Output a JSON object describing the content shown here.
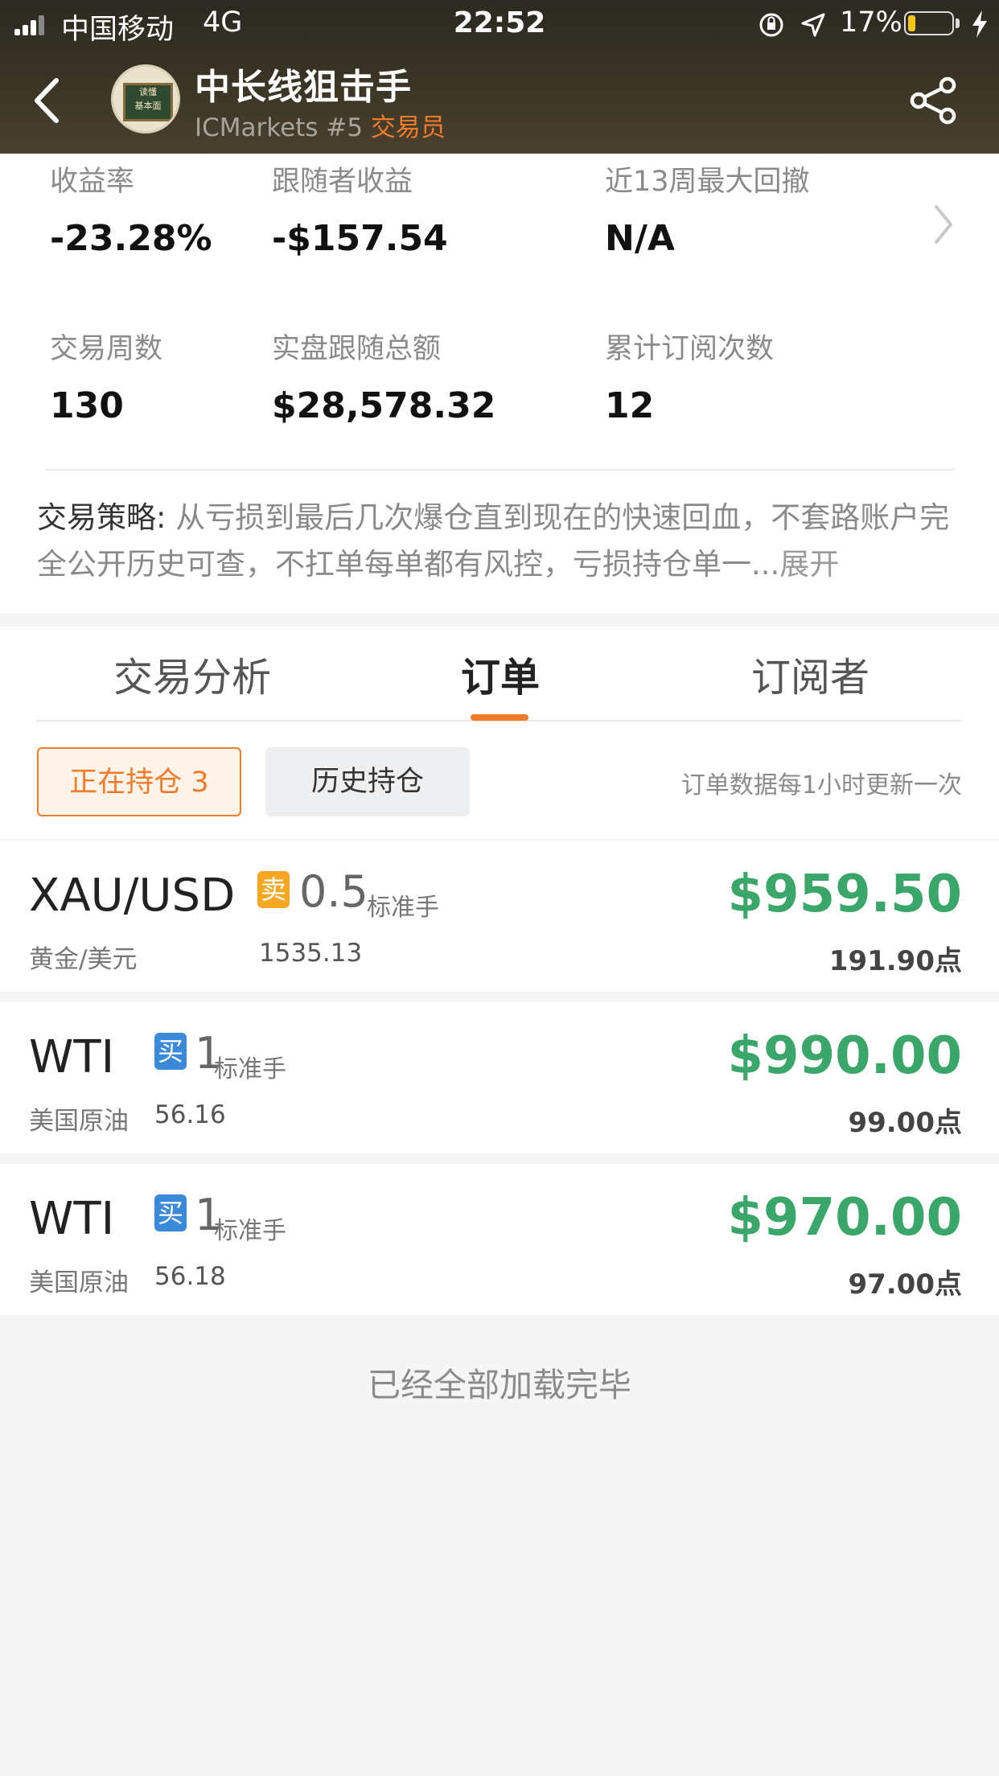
{
  "status_bar": {
    "carrier": "中国移动",
    "network": "4G",
    "time": "22:52",
    "battery": "17%",
    "battery_level": 0.17
  },
  "header": {
    "trader_name": "中长线狙击手",
    "broker": "ICMarkets #5",
    "role": "交易员",
    "avatar_text_1": "读懂",
    "avatar_text_2": "基本面"
  },
  "stats": [
    {
      "label": "收益率",
      "value": "-23.28%"
    },
    {
      "label": "跟随者收益",
      "value": "-$157.54"
    },
    {
      "label": "近13周最大回撤",
      "value": "N/A"
    },
    {
      "label": "交易周数",
      "value": "130"
    },
    {
      "label": "实盘跟随总额",
      "value": "$28,578.32"
    },
    {
      "label": "累计订阅次数",
      "value": "12"
    }
  ],
  "strategy": {
    "prefix": "交易策略: ",
    "text": "从亏损到最后几次爆仓直到现在的快速回血，不套路账户完全公开历史可查，不扛单每单都有风控，亏损持仓单一...",
    "more": "展开"
  },
  "tabs": [
    {
      "label": "交易分析"
    },
    {
      "label": "订单"
    },
    {
      "label": "订阅者"
    }
  ],
  "filters": {
    "open_positions": "正在持仓 3",
    "history": "历史持仓",
    "update_note": "订单数据每1小时更新一次"
  },
  "orders": [
    {
      "symbol": "XAU/USD",
      "side": "卖",
      "lots": "0.5",
      "unit": "标准手",
      "name_cn": "黄金/美元",
      "open_price": "1535.13",
      "profit": "$959.50",
      "points": "191.90点"
    },
    {
      "symbol": "WTI",
      "side": "买",
      "lots": "1",
      "unit": "标准手",
      "name_cn": "美国原油",
      "open_price": "56.16",
      "profit": "$990.00",
      "points": "99.00点"
    },
    {
      "symbol": "WTI",
      "side": "买",
      "lots": "1",
      "unit": "标准手",
      "name_cn": "美国原油",
      "open_price": "56.18",
      "profit": "$970.00",
      "points": "97.00点"
    }
  ],
  "footer": "已经全部加载完毕",
  "colors": {
    "accent": "#f07c2a",
    "profit": "#3aa66a",
    "sell": "#f5a623",
    "buy": "#3b8ad9"
  }
}
